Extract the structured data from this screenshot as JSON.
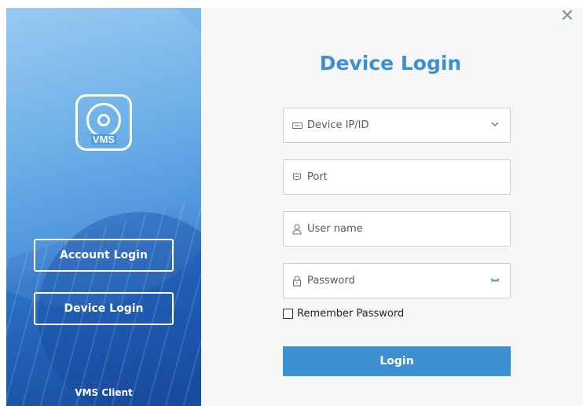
{
  "window": {
    "close_label": "✕"
  },
  "sidebar": {
    "logo_text": "VMS",
    "account_login_label": "Account Login",
    "device_login_label": "Device Login",
    "footer_label": "VMS Client"
  },
  "form": {
    "title": "Device Login",
    "device_ip": {
      "placeholder": "Device IP/ID",
      "icon": "device-icon"
    },
    "port": {
      "placeholder": "Port",
      "icon": "port-icon"
    },
    "username": {
      "placeholder": "User name",
      "icon": "user-icon"
    },
    "password": {
      "placeholder": "Password",
      "icon": "lock-icon"
    },
    "remember_label": "Remember Password",
    "login_label": "Login"
  },
  "colors": {
    "accent": "#3d8fd4",
    "sidebar_top": "#8fc4ef",
    "sidebar_bottom": "#1d5fb5"
  }
}
